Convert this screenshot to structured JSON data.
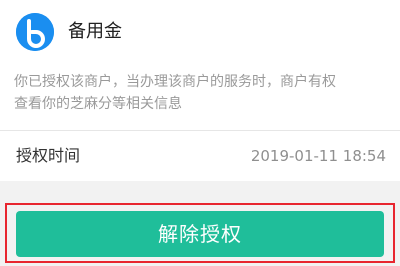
{
  "app": {
    "name": "备用金",
    "logo_icon": "brand-b-logo-icon",
    "logo_color": "#1a8ef0"
  },
  "description": "你已授权该商户，当办理该商户的服务时，商户有权\n查看你的芝麻分等相关信息",
  "authorization": {
    "label": "授权时间",
    "value": "2019-01-11 18:54"
  },
  "actions": {
    "revoke_label": "解除授权",
    "revoke_color": "#1fbe9a",
    "highlight_color": "#e8262f"
  }
}
